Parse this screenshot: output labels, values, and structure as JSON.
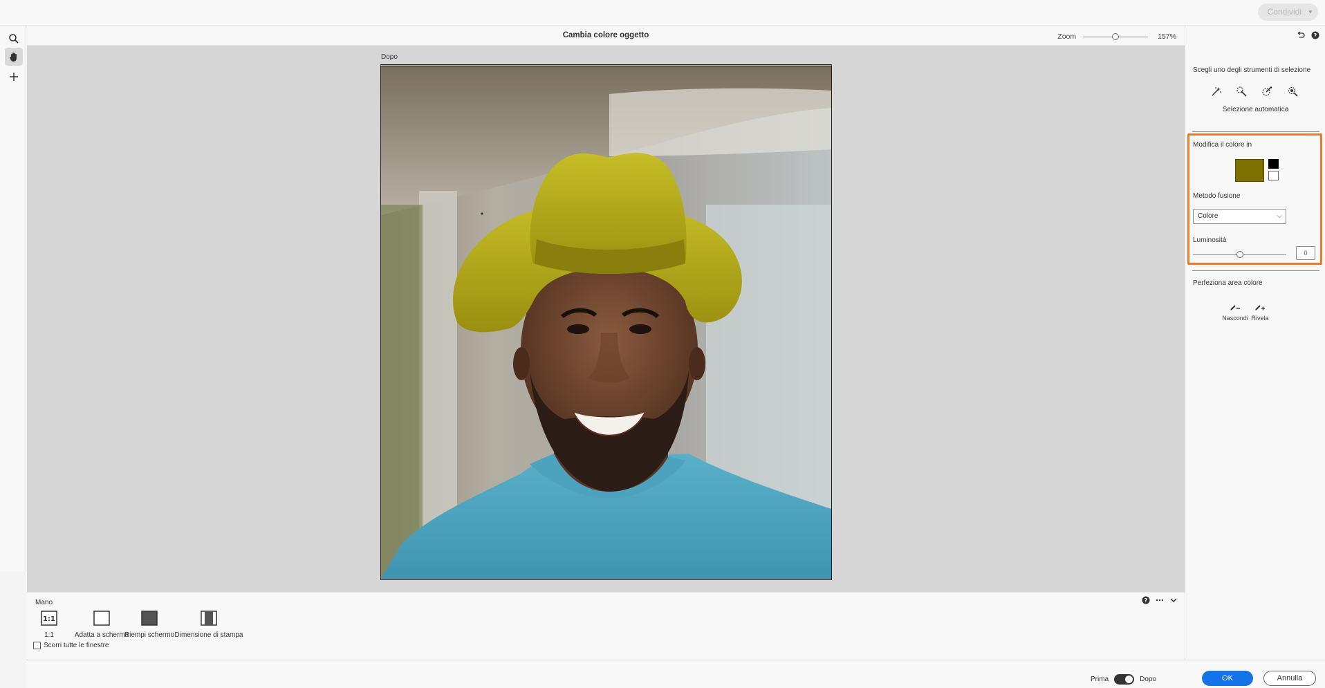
{
  "header": {
    "share_label": "Condividi"
  },
  "left_tools": [
    {
      "name": "zoom-tool",
      "icon": "search-icon"
    },
    {
      "name": "hand-tool",
      "icon": "hand-icon"
    },
    {
      "name": "move-tool",
      "icon": "plus-icon"
    }
  ],
  "canvas": {
    "title": "Cambia colore oggetto",
    "zoom_label": "Zoom",
    "zoom_value": "157%",
    "view_label": "Dopo"
  },
  "right_panel": {
    "selection_title": "Scegli uno degli strumenti di selezione",
    "selection_tools": [
      "magic-wand-icon",
      "quick-selection-icon",
      "auto-selection-icon",
      "refine-brush-icon"
    ],
    "selection_mode": "Selezione automatica",
    "change_color_title": "Modifica il colore in",
    "swatch_color": "#7e7000",
    "blend_title": "Metodo fusione",
    "blend_value": "Colore",
    "brightness_title": "Luminosità",
    "brightness_value": "0",
    "brightness_level": 0.5,
    "refine_title": "Perfeziona area colore",
    "refine_hide": "Nascondi",
    "refine_reveal": "Rivela",
    "highlight_color": "#ea7b2a"
  },
  "options_bar": {
    "title": "Mano",
    "items": [
      "1:1",
      "Adatta a schermo",
      "Riempi schermo",
      "Dimensione di stampa"
    ],
    "icon_11_text": "1:1",
    "scroll_all": "Scorri tutte le finestre"
  },
  "footer": {
    "before_label": "Prima",
    "after_label": "Dopo",
    "ok_label": "OK",
    "cancel_label": "Annulla",
    "accent": "#1473e6"
  }
}
